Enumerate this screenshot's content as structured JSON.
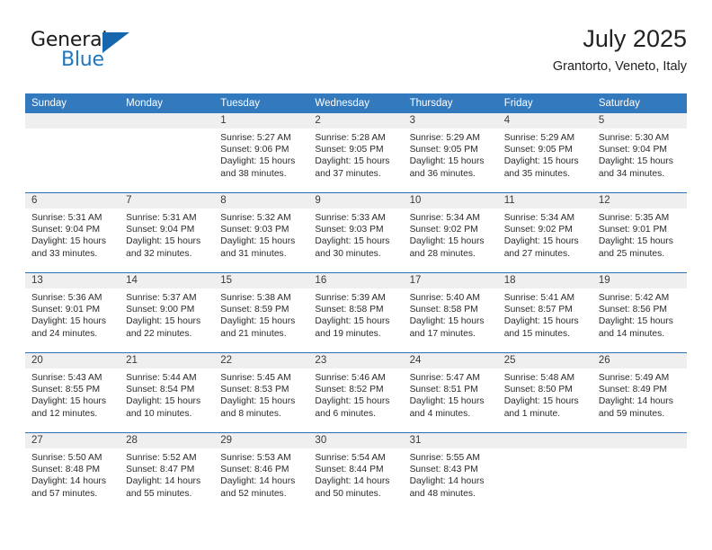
{
  "brand": {
    "name_part1": "General",
    "name_part2": "Blue",
    "triangle_color": "#1667ae"
  },
  "header": {
    "month_title": "July 2025",
    "location": "Grantorto, Veneto, Italy",
    "header_bg_color": "#3379bd",
    "row_separator_color": "#2d6fb5",
    "daynum_band_color": "#efefef"
  },
  "weekday_headers": [
    "Sunday",
    "Monday",
    "Tuesday",
    "Wednesday",
    "Thursday",
    "Friday",
    "Saturday"
  ],
  "weeks": [
    [
      {
        "day": "",
        "empty": true,
        "sunrise": "",
        "sunset": "",
        "daylight_line1": "",
        "daylight_line2": ""
      },
      {
        "day": "",
        "empty": true,
        "sunrise": "",
        "sunset": "",
        "daylight_line1": "",
        "daylight_line2": ""
      },
      {
        "day": "1",
        "empty": false,
        "sunrise": "Sunrise: 5:27 AM",
        "sunset": "Sunset: 9:06 PM",
        "daylight_line1": "Daylight: 15 hours",
        "daylight_line2": "and 38 minutes."
      },
      {
        "day": "2",
        "empty": false,
        "sunrise": "Sunrise: 5:28 AM",
        "sunset": "Sunset: 9:05 PM",
        "daylight_line1": "Daylight: 15 hours",
        "daylight_line2": "and 37 minutes."
      },
      {
        "day": "3",
        "empty": false,
        "sunrise": "Sunrise: 5:29 AM",
        "sunset": "Sunset: 9:05 PM",
        "daylight_line1": "Daylight: 15 hours",
        "daylight_line2": "and 36 minutes."
      },
      {
        "day": "4",
        "empty": false,
        "sunrise": "Sunrise: 5:29 AM",
        "sunset": "Sunset: 9:05 PM",
        "daylight_line1": "Daylight: 15 hours",
        "daylight_line2": "and 35 minutes."
      },
      {
        "day": "5",
        "empty": false,
        "sunrise": "Sunrise: 5:30 AM",
        "sunset": "Sunset: 9:04 PM",
        "daylight_line1": "Daylight: 15 hours",
        "daylight_line2": "and 34 minutes."
      }
    ],
    [
      {
        "day": "6",
        "empty": false,
        "sunrise": "Sunrise: 5:31 AM",
        "sunset": "Sunset: 9:04 PM",
        "daylight_line1": "Daylight: 15 hours",
        "daylight_line2": "and 33 minutes."
      },
      {
        "day": "7",
        "empty": false,
        "sunrise": "Sunrise: 5:31 AM",
        "sunset": "Sunset: 9:04 PM",
        "daylight_line1": "Daylight: 15 hours",
        "daylight_line2": "and 32 minutes."
      },
      {
        "day": "8",
        "empty": false,
        "sunrise": "Sunrise: 5:32 AM",
        "sunset": "Sunset: 9:03 PM",
        "daylight_line1": "Daylight: 15 hours",
        "daylight_line2": "and 31 minutes."
      },
      {
        "day": "9",
        "empty": false,
        "sunrise": "Sunrise: 5:33 AM",
        "sunset": "Sunset: 9:03 PM",
        "daylight_line1": "Daylight: 15 hours",
        "daylight_line2": "and 30 minutes."
      },
      {
        "day": "10",
        "empty": false,
        "sunrise": "Sunrise: 5:34 AM",
        "sunset": "Sunset: 9:02 PM",
        "daylight_line1": "Daylight: 15 hours",
        "daylight_line2": "and 28 minutes."
      },
      {
        "day": "11",
        "empty": false,
        "sunrise": "Sunrise: 5:34 AM",
        "sunset": "Sunset: 9:02 PM",
        "daylight_line1": "Daylight: 15 hours",
        "daylight_line2": "and 27 minutes."
      },
      {
        "day": "12",
        "empty": false,
        "sunrise": "Sunrise: 5:35 AM",
        "sunset": "Sunset: 9:01 PM",
        "daylight_line1": "Daylight: 15 hours",
        "daylight_line2": "and 25 minutes."
      }
    ],
    [
      {
        "day": "13",
        "empty": false,
        "sunrise": "Sunrise: 5:36 AM",
        "sunset": "Sunset: 9:01 PM",
        "daylight_line1": "Daylight: 15 hours",
        "daylight_line2": "and 24 minutes."
      },
      {
        "day": "14",
        "empty": false,
        "sunrise": "Sunrise: 5:37 AM",
        "sunset": "Sunset: 9:00 PM",
        "daylight_line1": "Daylight: 15 hours",
        "daylight_line2": "and 22 minutes."
      },
      {
        "day": "15",
        "empty": false,
        "sunrise": "Sunrise: 5:38 AM",
        "sunset": "Sunset: 8:59 PM",
        "daylight_line1": "Daylight: 15 hours",
        "daylight_line2": "and 21 minutes."
      },
      {
        "day": "16",
        "empty": false,
        "sunrise": "Sunrise: 5:39 AM",
        "sunset": "Sunset: 8:58 PM",
        "daylight_line1": "Daylight: 15 hours",
        "daylight_line2": "and 19 minutes."
      },
      {
        "day": "17",
        "empty": false,
        "sunrise": "Sunrise: 5:40 AM",
        "sunset": "Sunset: 8:58 PM",
        "daylight_line1": "Daylight: 15 hours",
        "daylight_line2": "and 17 minutes."
      },
      {
        "day": "18",
        "empty": false,
        "sunrise": "Sunrise: 5:41 AM",
        "sunset": "Sunset: 8:57 PM",
        "daylight_line1": "Daylight: 15 hours",
        "daylight_line2": "and 15 minutes."
      },
      {
        "day": "19",
        "empty": false,
        "sunrise": "Sunrise: 5:42 AM",
        "sunset": "Sunset: 8:56 PM",
        "daylight_line1": "Daylight: 15 hours",
        "daylight_line2": "and 14 minutes."
      }
    ],
    [
      {
        "day": "20",
        "empty": false,
        "sunrise": "Sunrise: 5:43 AM",
        "sunset": "Sunset: 8:55 PM",
        "daylight_line1": "Daylight: 15 hours",
        "daylight_line2": "and 12 minutes."
      },
      {
        "day": "21",
        "empty": false,
        "sunrise": "Sunrise: 5:44 AM",
        "sunset": "Sunset: 8:54 PM",
        "daylight_line1": "Daylight: 15 hours",
        "daylight_line2": "and 10 minutes."
      },
      {
        "day": "22",
        "empty": false,
        "sunrise": "Sunrise: 5:45 AM",
        "sunset": "Sunset: 8:53 PM",
        "daylight_line1": "Daylight: 15 hours",
        "daylight_line2": "and 8 minutes."
      },
      {
        "day": "23",
        "empty": false,
        "sunrise": "Sunrise: 5:46 AM",
        "sunset": "Sunset: 8:52 PM",
        "daylight_line1": "Daylight: 15 hours",
        "daylight_line2": "and 6 minutes."
      },
      {
        "day": "24",
        "empty": false,
        "sunrise": "Sunrise: 5:47 AM",
        "sunset": "Sunset: 8:51 PM",
        "daylight_line1": "Daylight: 15 hours",
        "daylight_line2": "and 4 minutes."
      },
      {
        "day": "25",
        "empty": false,
        "sunrise": "Sunrise: 5:48 AM",
        "sunset": "Sunset: 8:50 PM",
        "daylight_line1": "Daylight: 15 hours",
        "daylight_line2": "and 1 minute."
      },
      {
        "day": "26",
        "empty": false,
        "sunrise": "Sunrise: 5:49 AM",
        "sunset": "Sunset: 8:49 PM",
        "daylight_line1": "Daylight: 14 hours",
        "daylight_line2": "and 59 minutes."
      }
    ],
    [
      {
        "day": "27",
        "empty": false,
        "sunrise": "Sunrise: 5:50 AM",
        "sunset": "Sunset: 8:48 PM",
        "daylight_line1": "Daylight: 14 hours",
        "daylight_line2": "and 57 minutes."
      },
      {
        "day": "28",
        "empty": false,
        "sunrise": "Sunrise: 5:52 AM",
        "sunset": "Sunset: 8:47 PM",
        "daylight_line1": "Daylight: 14 hours",
        "daylight_line2": "and 55 minutes."
      },
      {
        "day": "29",
        "empty": false,
        "sunrise": "Sunrise: 5:53 AM",
        "sunset": "Sunset: 8:46 PM",
        "daylight_line1": "Daylight: 14 hours",
        "daylight_line2": "and 52 minutes."
      },
      {
        "day": "30",
        "empty": false,
        "sunrise": "Sunrise: 5:54 AM",
        "sunset": "Sunset: 8:44 PM",
        "daylight_line1": "Daylight: 14 hours",
        "daylight_line2": "and 50 minutes."
      },
      {
        "day": "31",
        "empty": false,
        "sunrise": "Sunrise: 5:55 AM",
        "sunset": "Sunset: 8:43 PM",
        "daylight_line1": "Daylight: 14 hours",
        "daylight_line2": "and 48 minutes."
      },
      {
        "day": "",
        "empty": true,
        "sunrise": "",
        "sunset": "",
        "daylight_line1": "",
        "daylight_line2": ""
      },
      {
        "day": "",
        "empty": true,
        "sunrise": "",
        "sunset": "",
        "daylight_line1": "",
        "daylight_line2": ""
      }
    ]
  ]
}
